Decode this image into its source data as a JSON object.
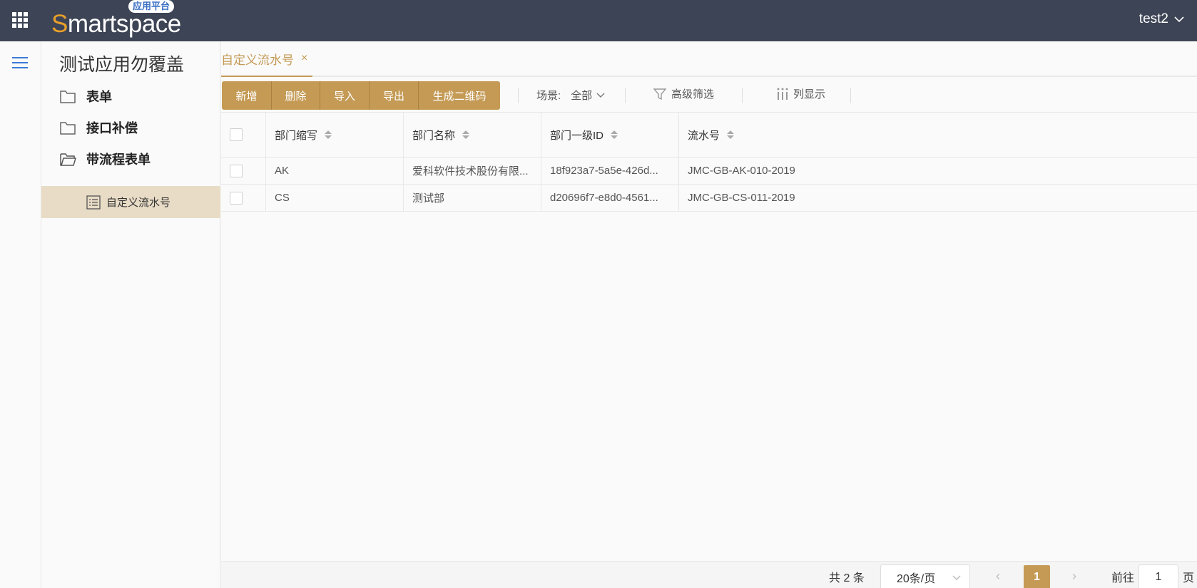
{
  "header": {
    "logo_s": "S",
    "logo_rest": "martspace",
    "logo_badge": "应用平台",
    "user": "test2"
  },
  "sidebar": {
    "app_title": "测试应用勿覆盖",
    "items": [
      {
        "label": "表单",
        "icon": "folder-icon"
      },
      {
        "label": "接口补偿",
        "icon": "folder-icon"
      },
      {
        "label": "带流程表单",
        "icon": "folder-open-icon"
      }
    ],
    "sub_item": {
      "label": "自定义流水号",
      "icon": "list-icon"
    }
  },
  "tabs": [
    {
      "label": "自定义流水号",
      "close": "×"
    }
  ],
  "toolbar": {
    "buttons": [
      "新增",
      "删除",
      "导入",
      "导出",
      "生成二维码"
    ],
    "scene_label": "场景:",
    "scene_value": "全部",
    "filter_label": "高级筛选",
    "columns_label": "列显示"
  },
  "table": {
    "headers": [
      "部门缩写",
      "部门名称",
      "部门一级ID",
      "流水号"
    ],
    "rows": [
      [
        "AK",
        "爱科软件技术股份有限...",
        "18f923a7-5a5e-426d...",
        "JMC-GB-AK-010-2019"
      ],
      [
        "CS",
        "测试部",
        "d20696f7-e8d0-4561...",
        "JMC-GB-CS-011-2019"
      ]
    ]
  },
  "pagination": {
    "total": "共 2 条",
    "page_size": "20条/页",
    "prev": "‹",
    "current": "1",
    "next": "›",
    "goto_label": "前往",
    "goto_value": "1",
    "page_suffix": "页"
  },
  "colors": {
    "accent": "#c49a55",
    "topbar": "#3d4455",
    "selected_nav": "#e8dcc6"
  }
}
